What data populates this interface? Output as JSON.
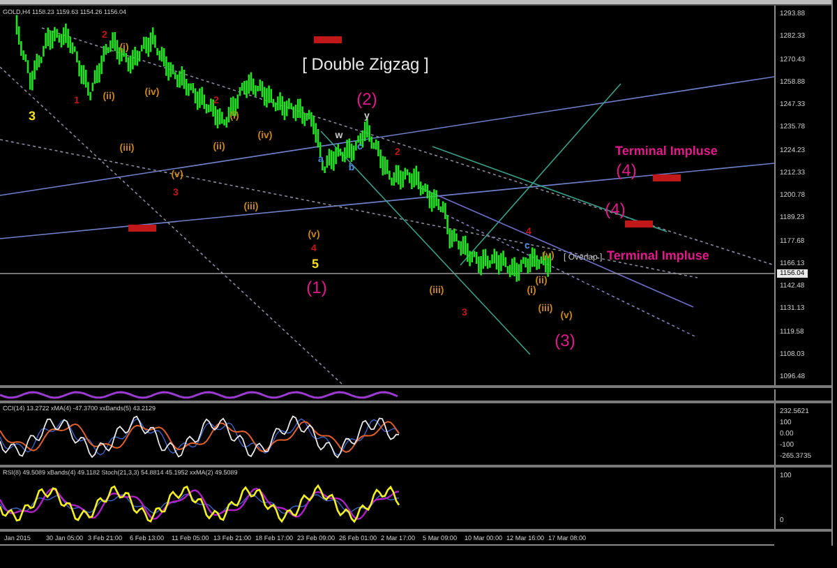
{
  "header": {
    "symbol_line": "GOLD,H4 1158.23 1159.63 1154.26 1156.04"
  },
  "main_chart": {
    "price_axis": [
      "1293.88",
      "1282.33",
      "1270.43",
      "1258.88",
      "1247.33",
      "1235.78",
      "1224.23",
      "1212.33",
      "1200.78",
      "1189.23",
      "1177.68",
      "1166.13",
      "1142.48",
      "1131.13",
      "1119.58",
      "1108.03",
      "1096.48"
    ],
    "current_price": "1156.04",
    "labels": [
      {
        "text": "[ Double Zigzag ]",
        "color": "#e8e8e8"
      },
      {
        "text": "(2)",
        "color": "#e0198a"
      },
      {
        "text": "3",
        "color": "#f2e020"
      },
      {
        "text": "5",
        "color": "#f2e020"
      },
      {
        "text": "(1)",
        "color": "#e0198a"
      },
      {
        "text": "Terminal Impluse",
        "color": "#e0198a"
      },
      {
        "text": "(4)",
        "color": "#e0198a"
      },
      {
        "text": "(4)",
        "color": "#e0198a"
      },
      {
        "text": "[ Overlap ]",
        "color": "#c8c8c8"
      },
      {
        "text": "Terminal Impluse",
        "color": "#e0198a"
      },
      {
        "text": "(3)",
        "color": "#e0198a"
      },
      {
        "text": "w",
        "color": "#c8c8c8"
      },
      {
        "text": "y",
        "color": "#c8c8c8"
      },
      {
        "text": "2",
        "color": "#c01818"
      },
      {
        "text": "(i)",
        "color": "#c8861a"
      },
      {
        "text": "1",
        "color": "#c01818"
      },
      {
        "text": "(ii)",
        "color": "#c8861a"
      },
      {
        "text": "(iv)",
        "color": "#c8861a"
      },
      {
        "text": "2",
        "color": "#c01818"
      },
      {
        "text": "(i)",
        "color": "#c8861a"
      },
      {
        "text": "(iii)",
        "color": "#c8861a"
      },
      {
        "text": "(ii)",
        "color": "#c8861a"
      },
      {
        "text": "(iv)",
        "color": "#c8861a"
      },
      {
        "text": "(v)",
        "color": "#c8861a"
      },
      {
        "text": "3",
        "color": "#c01818"
      },
      {
        "text": "(iii)",
        "color": "#c8861a"
      },
      {
        "text": "(v)",
        "color": "#c8861a"
      },
      {
        "text": "4",
        "color": "#c01818"
      },
      {
        "text": "2",
        "color": "#c01818"
      },
      {
        "text": "a",
        "color": "#4d8de0"
      },
      {
        "text": "b",
        "color": "#4d8de0"
      },
      {
        "text": "c",
        "color": "#4d8de0"
      },
      {
        "text": "3",
        "color": "#c01818"
      },
      {
        "text": "(iii)",
        "color": "#c8861a"
      },
      {
        "text": "(iii)",
        "color": "#c8861a"
      },
      {
        "text": "(v)",
        "color": "#c8861a"
      },
      {
        "text": "4",
        "color": "#c01818"
      },
      {
        "text": "c",
        "color": "#4d8de0"
      },
      {
        "text": "(v)",
        "color": "#c8861a"
      },
      {
        "text": "(ii)",
        "color": "#c8861a"
      },
      {
        "text": "(i)",
        "color": "#c8861a"
      }
    ]
  },
  "cci_pane": {
    "legend": "CCI(14) 13.2722  xMA(4) -47.3700  xxBands(5) 43.2129",
    "axis": [
      "232.5621",
      "100",
      "0.00",
      "-100",
      "-265.3735"
    ]
  },
  "rsi_pane": {
    "legend": "RSI(8) 49.5089  xBands(4) 49.1182  Stoch(21,3,3) 54.8814 45.1952  xxMA(2) 49.5089",
    "axis": [
      "100",
      "0"
    ]
  },
  "time_axis": [
    "Jan 2015",
    "30 Jan 05:00",
    "3 Feb 21:00",
    "6 Feb 13:00",
    "11 Feb 05:00",
    "13 Feb 21:00",
    "18 Feb 17:00",
    "23 Feb 09:00",
    "26 Feb 01:00",
    "2 Mar 17:00",
    "5 Mar 09:00",
    "10 Mar 00:00",
    "12 Mar 16:00",
    "17 Mar 08:00"
  ]
}
